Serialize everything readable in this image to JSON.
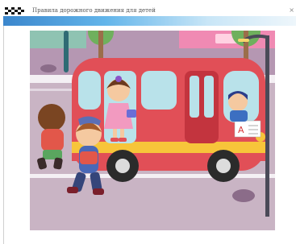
{
  "window": {
    "title": "Правила дорожного движения для детей",
    "close_glyph": "×"
  },
  "scene": {
    "bus_sign_letter": "A",
    "colors": {
      "road": "#c9b4c4",
      "sidewalk": "#b597b2",
      "bus_body": "#e14f57",
      "bus_window": "#b9e2ea",
      "bus_stripe": "#f7c53a"
    }
  }
}
